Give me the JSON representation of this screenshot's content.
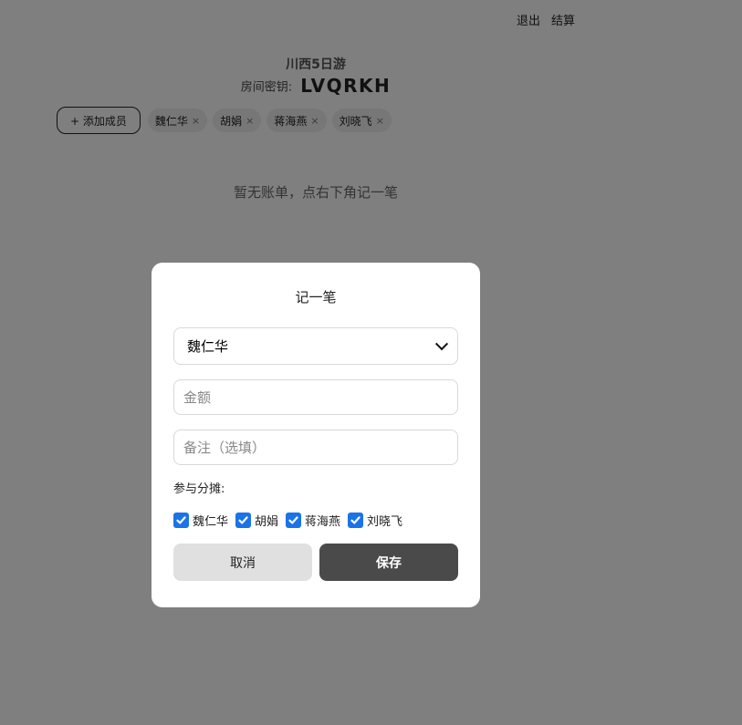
{
  "header": {
    "logout_label": "退出",
    "settle_label": "结算"
  },
  "trip": {
    "title": "川西5日游",
    "room_key_label": "房间密钥:",
    "room_key": "LVQRKH"
  },
  "members": {
    "add_label": "+ 添加成员",
    "remove_glyph": "×",
    "items": [
      {
        "name": "魏仁华"
      },
      {
        "name": "胡娟"
      },
      {
        "name": "蒋海燕"
      },
      {
        "name": "刘晓飞"
      }
    ]
  },
  "empty_hint": "暂无账单，点右下角记一笔",
  "modal": {
    "title": "记一笔",
    "payer_selected": "魏仁华",
    "amount_placeholder": "金额",
    "note_placeholder": "备注（选填）",
    "split_label": "参与分摊:",
    "split_members": [
      {
        "name": "魏仁华",
        "checked": true
      },
      {
        "name": "胡娟",
        "checked": true
      },
      {
        "name": "蒋海燕",
        "checked": true
      },
      {
        "name": "刘晓飞",
        "checked": true
      }
    ],
    "cancel_label": "取消",
    "save_label": "保存"
  },
  "colors": {
    "checkbox": "#1a73e8",
    "save_button": "#4a4a4a",
    "cancel_button": "#e0e0e0",
    "overlay": "rgba(0,0,0,0.5)"
  }
}
